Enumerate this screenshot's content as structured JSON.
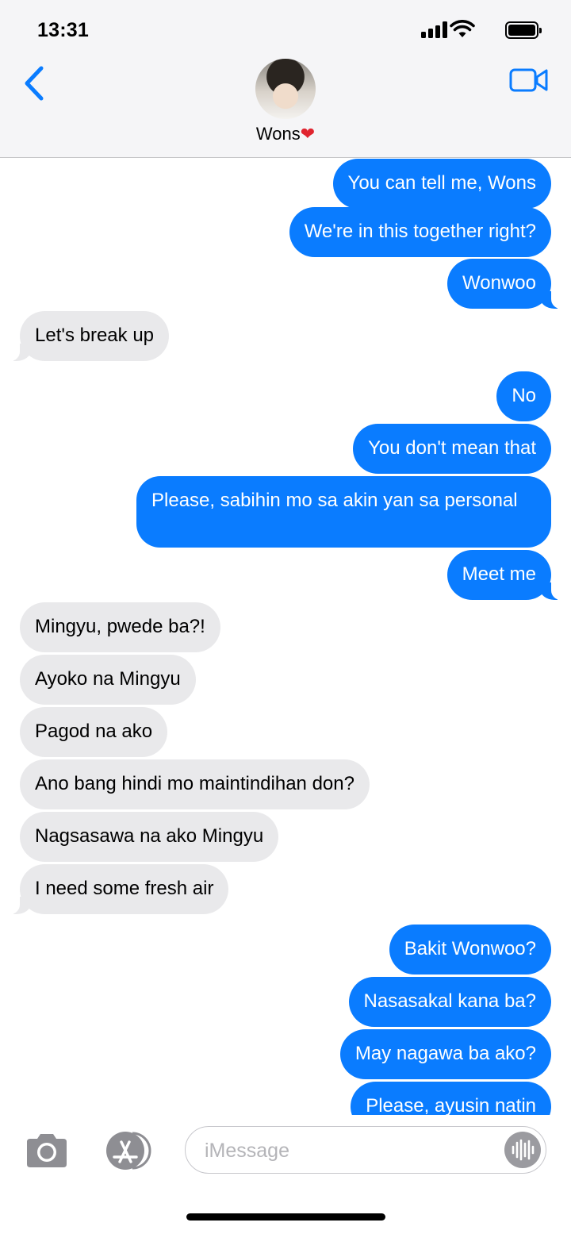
{
  "status_bar": {
    "time": "13:31"
  },
  "header": {
    "contact_name": "Wons",
    "contact_emoji": "❤"
  },
  "messages": [
    {
      "direction": "outgoing",
      "text": "You can tell me, Wons"
    },
    {
      "direction": "outgoing",
      "text": "We're in this together right?"
    },
    {
      "direction": "outgoing",
      "text": "Wonwoo"
    },
    {
      "direction": "incoming",
      "text": "Let's break up"
    },
    {
      "direction": "outgoing",
      "text": "No"
    },
    {
      "direction": "outgoing",
      "text": "You don't mean that"
    },
    {
      "direction": "outgoing",
      "text": "Please, sabihin mo sa akin yan sa personal"
    },
    {
      "direction": "outgoing",
      "text": "Meet me"
    },
    {
      "direction": "incoming",
      "text": "Mingyu, pwede ba?!"
    },
    {
      "direction": "incoming",
      "text": "Ayoko na Mingyu"
    },
    {
      "direction": "incoming",
      "text": "Pagod na ako"
    },
    {
      "direction": "incoming",
      "text": "Ano bang hindi mo maintindihan don?"
    },
    {
      "direction": "incoming",
      "text": "Nagsasawa na ako Mingyu"
    },
    {
      "direction": "incoming",
      "text": "I need some fresh air"
    },
    {
      "direction": "outgoing",
      "text": "Bakit Wonwoo?"
    },
    {
      "direction": "outgoing",
      "text": "Nasasakal kana ba?"
    },
    {
      "direction": "outgoing",
      "text": "May nagawa ba ako?"
    },
    {
      "direction": "outgoing",
      "text": "Please, ayusin natin"
    }
  ],
  "composer": {
    "placeholder": "iMessage"
  },
  "colors": {
    "outgoing_bubble": "#0a7cff",
    "incoming_bubble": "#e9e9eb",
    "accent": "#0a7cff",
    "header_bg": "#f5f5f7"
  },
  "icons": {
    "back": "chevron-left-icon",
    "video": "video-camera-icon",
    "camera": "camera-icon",
    "apps": "app-store-icon",
    "audio": "waveform-icon"
  }
}
